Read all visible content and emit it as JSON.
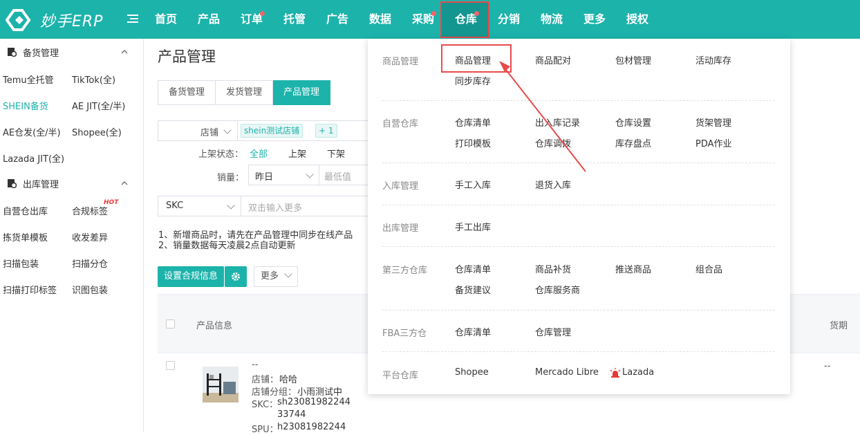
{
  "app": {
    "logo_text": "妙手ERP"
  },
  "nav": {
    "items": [
      {
        "label": "首页"
      },
      {
        "label": "产品"
      },
      {
        "label": "订单"
      },
      {
        "label": "托管"
      },
      {
        "label": "广告"
      },
      {
        "label": "数据"
      },
      {
        "label": "采购"
      },
      {
        "label": "仓库"
      },
      {
        "label": "分销"
      },
      {
        "label": "物流"
      },
      {
        "label": "更多"
      },
      {
        "label": "授权"
      }
    ],
    "active": "仓库",
    "dot_items": [
      "订单",
      "采购",
      "仓库"
    ]
  },
  "sidebar": {
    "section1": {
      "title": "备货管理",
      "links": [
        "Temu全托管",
        "TikTok(全)",
        "SHEIN备货",
        "AE JIT(全/半)",
        "AE仓发(全/半)",
        "Shopee(全)",
        "Lazada JIT(全)"
      ],
      "active": "SHEIN备货"
    },
    "section2": {
      "title": "出库管理",
      "links": [
        "自营仓出库",
        "合规标签",
        "拣货单模板",
        "收发差异",
        "扫描包装",
        "扫描分仓",
        "扫描打印标签",
        "识图包装"
      ],
      "hot_badge": "HOT"
    }
  },
  "main": {
    "title": "产品管理",
    "tabs": [
      {
        "label": "备货管理"
      },
      {
        "label": "发货管理"
      },
      {
        "label": "产品管理"
      }
    ],
    "filters": {
      "shop_label": "店铺",
      "shop_tag": "shein测试店铺",
      "shop_more": "+ 1",
      "status_label": "上架状态：",
      "status_options": [
        "全部",
        "上架",
        "下架"
      ],
      "sales_label": "销量：",
      "sales_period": "昨日",
      "sales_min_placeholder": "最低值",
      "search_type": "SKC",
      "search_placeholder": "双击输入更多"
    },
    "notes": [
      "1、新增商品时，请先在产品管理中同步在线产品",
      "2、销量数据每天凌晨2点自动更新"
    ],
    "buttons": {
      "set_compliance": "设置合规信息",
      "more": "更多"
    },
    "table": {
      "headers": {
        "product_info": "产品信息",
        "payment_term": "货期"
      },
      "row": {
        "title": "--",
        "shop_label": "店铺：",
        "shop_value": "哈哈",
        "group_label": "店铺分组：",
        "group_value": "小雨测试中",
        "skc_label": "SKC：",
        "skc_value_1": "sh23081982244",
        "skc_value_2": "33744",
        "spu_label": "SPU：",
        "spu_value": "h23081982244",
        "payment_term_value": "--"
      }
    }
  },
  "dropdown": {
    "groups": [
      {
        "name": "商品管理",
        "items": [
          "商品管理",
          "商品配对",
          "包材管理",
          "活动库存",
          "同步库存"
        ]
      },
      {
        "name": "自营仓库",
        "items": [
          "仓库清单",
          "出入库记录",
          "仓库设置",
          "货架管理",
          "打印模板",
          "仓库调拨",
          "库存盘点",
          "PDA作业"
        ]
      },
      {
        "name": "入库管理",
        "items": [
          "手工入库",
          "退货入库"
        ]
      },
      {
        "name": "出库管理",
        "items": [
          "手工出库"
        ]
      },
      {
        "name": "第三方仓库",
        "items": [
          "仓库清单",
          "商品补货",
          "推送商品",
          "组合品",
          "备货建议",
          "仓库服务商"
        ]
      },
      {
        "name": "FBA三方仓",
        "items": [
          "仓库清单",
          "仓库管理"
        ]
      },
      {
        "name": "平台仓库",
        "items": [
          "Shopee",
          "Mercado Libre",
          "Lazada"
        ]
      }
    ]
  },
  "colors": {
    "primary": "#1cb3ab",
    "highlight": "#e84a4a",
    "dot": "#f4636a"
  }
}
